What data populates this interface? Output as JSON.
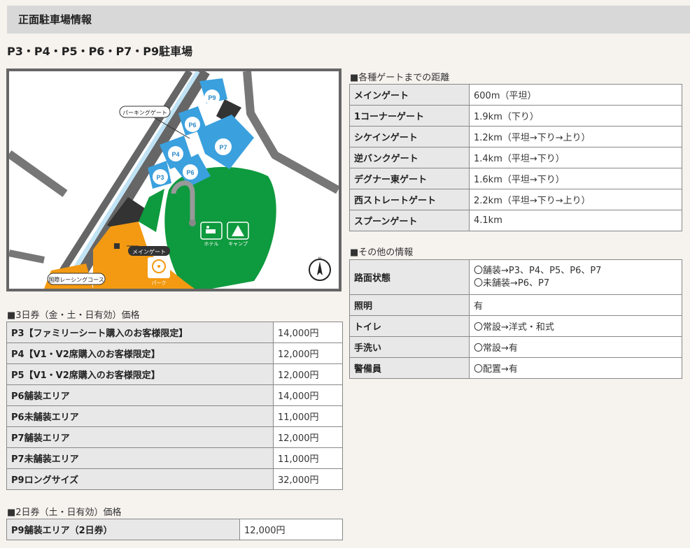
{
  "header": {
    "title": "正面駐車場情報"
  },
  "lot_title": "P3・P4・P5・P6・P7・P9駐車場",
  "map": {
    "labels": {
      "parking_gate": "パーキングゲート",
      "main_gate": "メインゲート",
      "course": "国際レーシングコース",
      "hotel": "ホテル",
      "camp": "キャンプ",
      "park": "パーク",
      "north": "N"
    },
    "lots": [
      "P9",
      "P6",
      "P7",
      "P4",
      "P3",
      "P6"
    ],
    "colors": {
      "blue": "#3aa0de",
      "green": "#0e9a3e",
      "orange": "#f39a12",
      "road": "#777777"
    }
  },
  "price_3day": {
    "caption": "■3日券（金・土・日有効）価格",
    "rows": [
      {
        "label": "P3【ファミリーシート購入のお客様限定】",
        "price": "14,000円"
      },
      {
        "label": "P4【V1・V2席購入のお客様限定】",
        "price": "12,000円"
      },
      {
        "label": "P5【V1・V2席購入のお客様限定】",
        "price": "12,000円"
      },
      {
        "label": "P6舗装エリア",
        "price": "14,000円"
      },
      {
        "label": "P6未舗装エリア",
        "price": "11,000円"
      },
      {
        "label": "P7舗装エリア",
        "price": "12,000円"
      },
      {
        "label": "P7未舗装エリア",
        "price": "11,000円"
      },
      {
        "label": "P9ロングサイズ",
        "price": "32,000円"
      }
    ]
  },
  "price_2day": {
    "caption": "■2日券（土・日有効）価格",
    "rows": [
      {
        "label": "P9舗装エリア（2日券）",
        "price": "12,000円"
      }
    ]
  },
  "gates": {
    "caption": "■各種ゲートまでの距離",
    "rows": [
      {
        "label": "メインゲート",
        "value": "600m（平坦）"
      },
      {
        "label": "1コーナーゲート",
        "value": "1.9km（下り）"
      },
      {
        "label": "シケインゲート",
        "value": "1.2km（平坦→下り→上り）"
      },
      {
        "label": "逆バンクゲート",
        "value": "1.4km（平坦→下り）"
      },
      {
        "label": "デグナー東ゲート",
        "value": "1.6km（平坦→下り）"
      },
      {
        "label": "西ストレートゲート",
        "value": "2.2km（平坦→下り→上り）"
      },
      {
        "label": "スプーンゲート",
        "value": "4.1km"
      }
    ]
  },
  "other": {
    "caption": "■その他の情報",
    "rows": [
      {
        "label": "路面状態",
        "value_lines": [
          "〇舗装→P3、P4、P5、P6、P7",
          "〇未舗装→P6、P7"
        ]
      },
      {
        "label": "照明",
        "value_lines": [
          "有"
        ]
      },
      {
        "label": "トイレ",
        "value_lines": [
          "〇常設→洋式・和式"
        ]
      },
      {
        "label": "手洗い",
        "value_lines": [
          "〇常設→有"
        ]
      },
      {
        "label": "警備員",
        "value_lines": [
          "〇配置→有"
        ]
      }
    ]
  }
}
